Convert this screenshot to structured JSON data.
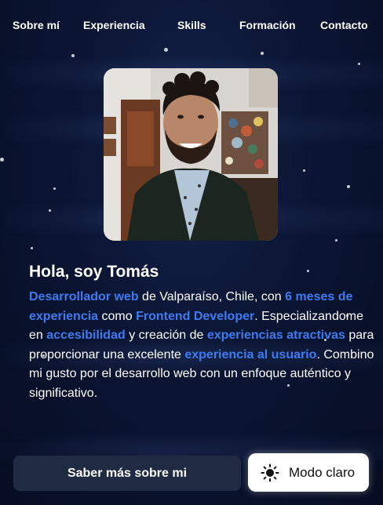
{
  "nav": {
    "items": [
      {
        "label": "Sobre mí"
      },
      {
        "label": "Experiencia"
      },
      {
        "label": "Skills"
      },
      {
        "label": "Formación"
      },
      {
        "label": "Contacto"
      }
    ]
  },
  "hero": {
    "title": "Hola, soy Tomás",
    "bio": [
      {
        "text": "Desarrollador web",
        "highlight": true
      },
      {
        "text": " de Valparaíso, Chile, con ",
        "highlight": false
      },
      {
        "text": "6 meses de experiencia",
        "highlight": true
      },
      {
        "text": " como ",
        "highlight": false
      },
      {
        "text": "Frontend Developer",
        "highlight": true
      },
      {
        "text": ". Especializandome en ",
        "highlight": false
      },
      {
        "text": "accesibilidad",
        "highlight": true
      },
      {
        "text": " y creación de ",
        "highlight": false
      },
      {
        "text": "experiencias atractivas",
        "highlight": true
      },
      {
        "text": " para proporcionar una excelente ",
        "highlight": false
      },
      {
        "text": "experiencia al usuario",
        "highlight": true
      },
      {
        "text": ". Combino mi gusto por el desarrollo web con un enfoque auténtico y significativo.",
        "highlight": false
      }
    ],
    "highlight_color": "#3d7bf0"
  },
  "actions": {
    "more_label": "Saber más sobre mi",
    "theme_label": "Modo claro",
    "theme_icon": "sun-icon"
  }
}
